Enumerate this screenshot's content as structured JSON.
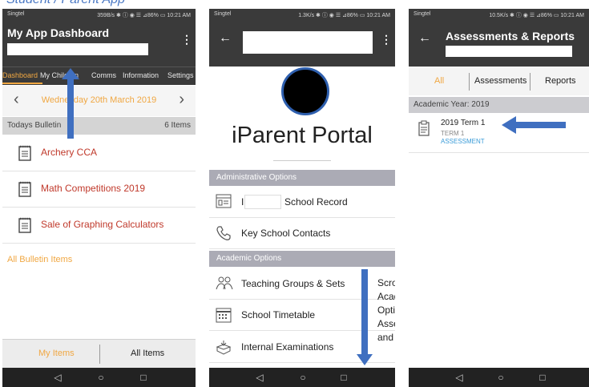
{
  "caption": "Student / Parent App",
  "phone1": {
    "status": {
      "carrier": "Singtel",
      "info": "359B/s ✱ ⓘ ◉ ☰ ⊿86% ▭ 10:21 AM"
    },
    "title": "My App Dashboard",
    "tabs": [
      "Dashboard",
      "My Children",
      "Comms",
      "Information",
      "Settings"
    ],
    "date": "Wednesday 20th March 2019",
    "bulletin_header": "Todays Bulletin",
    "bulletin_count": "6 Items",
    "items": [
      "Archery CCA",
      "Math Competitions 2019",
      "Sale of Graphing Calculators"
    ],
    "all_bulletin": "All Bulletin Items",
    "bottom_tabs": [
      "My Items",
      "All Items"
    ]
  },
  "phone2": {
    "status": {
      "carrier": "Singtel",
      "info": "1.3K/s ✱ ⓘ ◉ ☰ ⊿86% ▭ 10:21 AM"
    },
    "portal_title": "iParent Portal",
    "admin_section": "Administrative Options",
    "admin_items": [
      {
        "prefix": "I",
        "label": "School Record",
        "icon": "record-icon"
      },
      {
        "prefix": "",
        "label": "Key School Contacts",
        "icon": "phone-icon"
      }
    ],
    "academic_section": "Academic Options",
    "academic_items": [
      {
        "label": "Teaching Groups & Sets",
        "icon": "people-icon"
      },
      {
        "label": "School Timetable",
        "icon": "calendar-icon"
      },
      {
        "label": "Internal Examinations",
        "icon": "exam-icon"
      }
    ],
    "note": [
      "Scroll down",
      "Academic",
      "Options for",
      "Assessment",
      "and Report"
    ]
  },
  "phone3": {
    "status": {
      "carrier": "Singtel",
      "info": "10.5K/s ✱ ⓘ ◉ ☰ ⊿86% ▭ 10:21 AM"
    },
    "title": "Assessments & Reports",
    "tabs": [
      "All",
      "Assessments",
      "Reports"
    ],
    "year": "Academic Year: 2019",
    "term": {
      "title": "2019 Term 1",
      "sub": "TERM 1",
      "tag": "ASSESSMENT"
    }
  },
  "nav": {
    "back": "◁",
    "home": "○",
    "recents": "□"
  },
  "colors": {
    "accent": "#f0a742",
    "item_text": "#c0392b",
    "arrow": "#3f6fc0",
    "link": "#3a9bd8"
  }
}
